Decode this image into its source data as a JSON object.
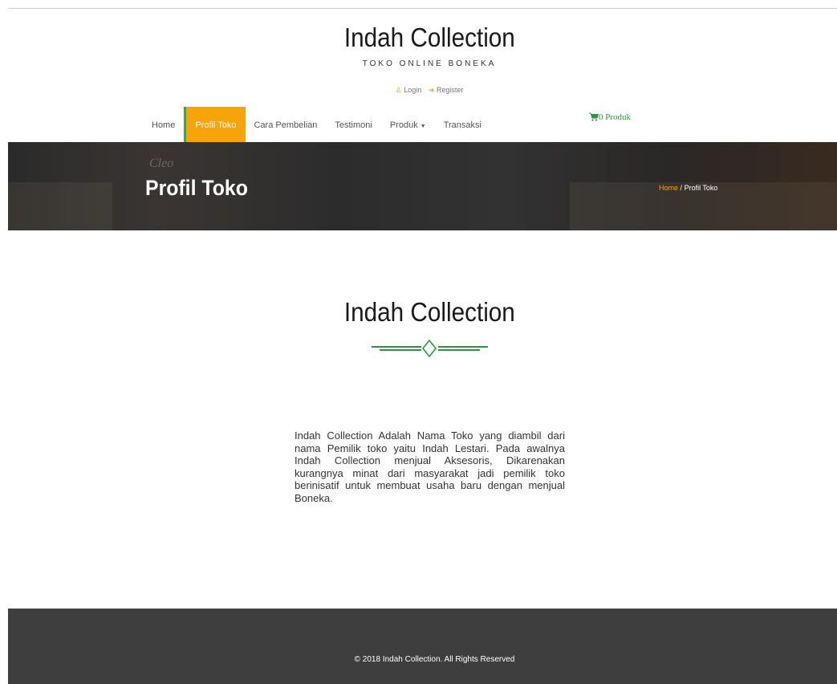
{
  "brand": {
    "title": "Indah Collection",
    "tagline": "TOKO ONLINE BONEKA"
  },
  "auth": {
    "login": "Login",
    "register": "Register"
  },
  "nav": {
    "items": [
      {
        "label": "Home"
      },
      {
        "label": "Profil Toko",
        "active": true
      },
      {
        "label": "Cara Pembelian"
      },
      {
        "label": "Testimoni"
      },
      {
        "label": "Produk"
      },
      {
        "label": "Transaksi"
      }
    ]
  },
  "cart": {
    "label": "0 Produk",
    "icon": "cart-icon",
    "color": "#2d9440"
  },
  "banner": {
    "ghost_text": "Cleo",
    "title": "Profil Toko",
    "breadcrumb_home": "Home",
    "breadcrumb_sep": "/",
    "breadcrumb_current": "Profil Toko"
  },
  "section": {
    "title": "Indah Collection",
    "description": "Indah Collection Adalah Nama Toko yang diambil dari nama Pemilik toko yaitu Indah Lestari. Pada awalnya Indah Collection menjual Aksesoris, Dikarenakan kurangnya minat dari masyarakat jadi pemilik toko berinisatif untuk membuat usaha baru dengan menjual Boneka."
  },
  "footer": {
    "copyright": "© 2018 Indah Collection. All Rights Reserved"
  },
  "colors": {
    "accent": "#f7a30a",
    "green": "#2d9440",
    "footer_bg": "#3e3e3e"
  }
}
